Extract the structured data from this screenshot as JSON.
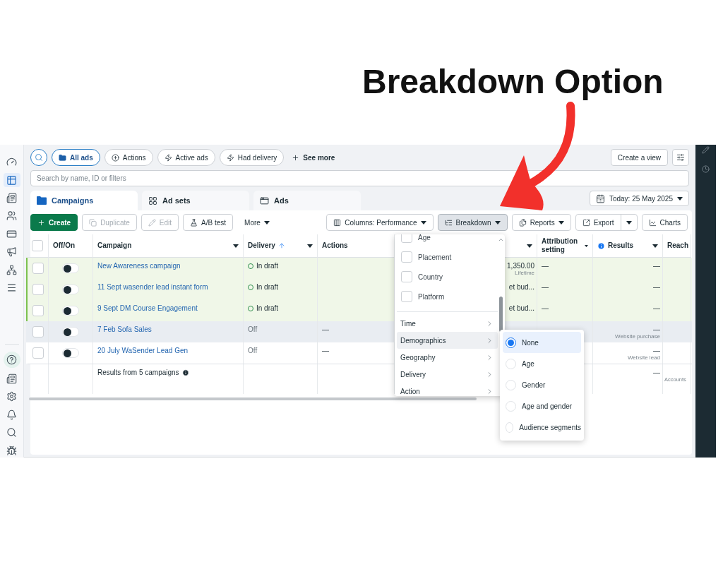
{
  "heading": "Breakdown Option",
  "filters": [
    {
      "label": "All ads",
      "selected": true
    },
    {
      "label": "Actions",
      "selected": false
    },
    {
      "label": "Active ads",
      "selected": false
    },
    {
      "label": "Had delivery",
      "selected": false
    }
  ],
  "sidebar_items": [
    {
      "selected": false
    },
    {
      "selected": true
    },
    {
      "selected": false
    },
    {
      "selected": false
    },
    {
      "selected": false
    },
    {
      "selected": false
    },
    {
      "selected": false
    },
    {
      "selected": false
    }
  ],
  "see_more": "See more",
  "create_view": "Create a view",
  "search": {
    "placeholder": "Search by name, ID or filters"
  },
  "level_tabs": [
    {
      "label": "Campaigns",
      "selected": true
    },
    {
      "label": "Ad sets",
      "selected": false
    },
    {
      "label": "Ads",
      "selected": false
    }
  ],
  "date": "Today: 25 May 2025",
  "actions": [
    {
      "label": "Create",
      "kind": "primary",
      "disabled": false
    },
    {
      "label": "Duplicate",
      "kind": "button",
      "disabled": true
    },
    {
      "label": "Edit",
      "kind": "button",
      "disabled": true
    },
    {
      "label": "A/B test",
      "kind": "button",
      "disabled": false
    },
    {
      "label": "More",
      "kind": "menu",
      "expanded": false
    }
  ],
  "views": [
    {
      "label": "Columns: Performance",
      "kind": "dropdown",
      "expanded": false
    },
    {
      "label": "Breakdown",
      "kind": "dropdown",
      "expanded": true
    },
    {
      "label": "Reports",
      "kind": "dropdown",
      "expanded": false
    },
    {
      "label": "Export",
      "kind": "split",
      "expanded": false
    },
    {
      "label": "Charts",
      "kind": "button"
    }
  ],
  "table": {
    "select_all": {
      "checked": false
    },
    "columns": [
      {
        "label": "Off/On"
      },
      {
        "label": "Campaign",
        "menu": true
      },
      {
        "label": "Delivery",
        "sorted": true,
        "menu": true
      },
      {
        "label": "Actions"
      },
      {
        "menu": true
      },
      {
        "label": "Attribution setting",
        "menu": true
      },
      {
        "label": "Results",
        "info": true,
        "menu": true
      },
      {
        "label": "Reach"
      }
    ],
    "rows": [
      {
        "campaign": "New Awareness campaign",
        "on": false,
        "draft": true,
        "hovered": false,
        "delivery": "In draft",
        "budget": "1,350.00",
        "budget_note": "Lifetime",
        "attribution": "—",
        "results": "—"
      },
      {
        "campaign": "11 Sept wasender lead instant form",
        "on": false,
        "draft": true,
        "hovered": false,
        "delivery": "In draft",
        "budget": "et bud...",
        "attribution": "—",
        "results": "—"
      },
      {
        "campaign": "9 Sept DM Course Engagement",
        "on": false,
        "draft": true,
        "hovered": false,
        "delivery": "In draft",
        "budget": "et bud...",
        "attribution": "—",
        "results": "—"
      },
      {
        "campaign": "7 Feb Sofa Sales",
        "on": false,
        "draft": false,
        "hovered": true,
        "delivery": "Off",
        "actions": "—",
        "results": "—",
        "result_type": "Website purchase"
      },
      {
        "campaign": "20 July WaSender Lead Gen",
        "on": false,
        "draft": false,
        "hovered": false,
        "delivery": "Off",
        "actions": "—",
        "results": "—",
        "result_type": "Website lead"
      }
    ],
    "summary": {
      "label": "Results from 5 campaigns",
      "results": "—",
      "reach": "Accounts"
    }
  },
  "breakdown_menu": {
    "checkboxes": [
      {
        "label": "Age",
        "checked": false
      },
      {
        "label": "Placement",
        "checked": false
      },
      {
        "label": "Country",
        "checked": false
      },
      {
        "label": "Platform",
        "checked": false
      }
    ],
    "groups": [
      {
        "label": "Time",
        "selected": false
      },
      {
        "label": "Demographics",
        "selected": true
      },
      {
        "label": "Geography",
        "selected": false
      },
      {
        "label": "Delivery",
        "selected": false
      },
      {
        "label": "Action",
        "selected": false
      }
    ],
    "submenu": [
      {
        "label": "None",
        "selected": true
      },
      {
        "label": "Age",
        "selected": false
      },
      {
        "label": "Gender",
        "selected": false
      },
      {
        "label": "Age and gender",
        "selected": false
      },
      {
        "label": "Audience segments",
        "selected": false
      }
    ]
  }
}
